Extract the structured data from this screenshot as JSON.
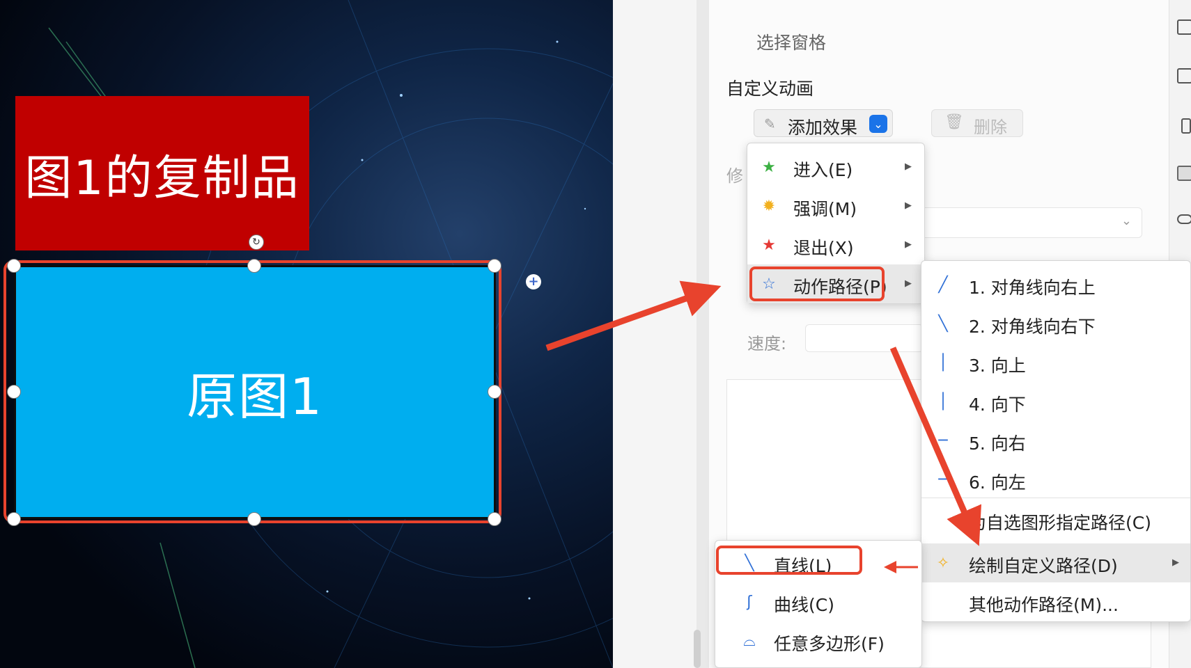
{
  "slide": {
    "copy_label": "图1的复制品",
    "original_label": "原图1"
  },
  "panel": {
    "selection_pane": "选择窗格",
    "custom_animation": "自定义动画",
    "add_effect": "添加效果",
    "delete": "删除",
    "modify_partial": "修",
    "speed_label": "速度:"
  },
  "effect_menu": {
    "items": [
      {
        "label": "进入(E)",
        "icon": "green-star-icon"
      },
      {
        "label": "强调(M)",
        "icon": "yellow-burst-icon"
      },
      {
        "label": "退出(X)",
        "icon": "red-star-icon"
      },
      {
        "label": "动作路径(P)",
        "icon": "blue-star-outline-icon"
      }
    ]
  },
  "motion_path_menu": {
    "items": [
      {
        "label": "1. 对角线向右上",
        "icon": "diagonal-up-right-icon"
      },
      {
        "label": "2. 对角线向右下",
        "icon": "diagonal-down-right-icon"
      },
      {
        "label": "3. 向上",
        "icon": "vertical-line-icon"
      },
      {
        "label": "4. 向下",
        "icon": "vertical-line-icon"
      },
      {
        "label": "5. 向右",
        "icon": "horizontal-line-icon"
      },
      {
        "label": "6. 向左",
        "icon": "horizontal-line-icon"
      },
      {
        "label": "为自选图形指定路径(C)",
        "icon": ""
      },
      {
        "label": "绘制自定义路径(D)",
        "icon": "custom-path-star-icon"
      },
      {
        "label": "其他动作路径(M)...",
        "icon": ""
      }
    ]
  },
  "custom_path_menu": {
    "items": [
      {
        "label": "直线(L)",
        "icon": "straight-line-icon"
      },
      {
        "label": "曲线(C)",
        "icon": "curve-icon"
      },
      {
        "label": "任意多边形(F)",
        "icon": "freeform-icon"
      }
    ]
  },
  "colors": {
    "annotation_red": "#e8432d",
    "copy_fill": "#c00000",
    "original_fill": "#00aeef",
    "accent_blue": "#1a73e8"
  }
}
